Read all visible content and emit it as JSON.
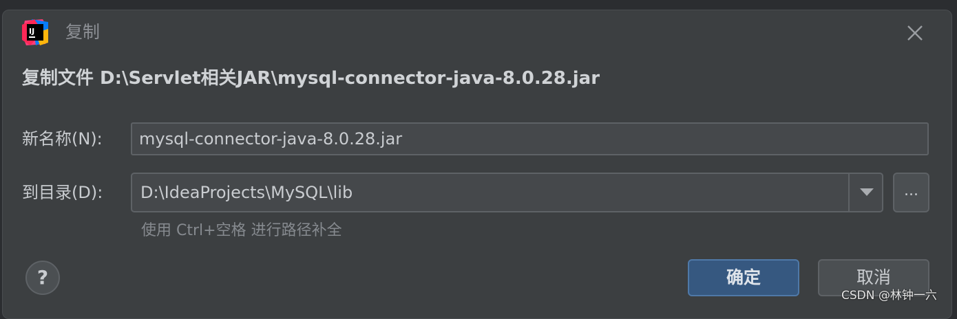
{
  "dialog": {
    "title": "复制",
    "heading": "复制文件 D:\\Servlet相关JAR\\mysql-connector-java-8.0.28.jar"
  },
  "form": {
    "name_label": "新名称(N):",
    "name_value": "mysql-connector-java-8.0.28.jar",
    "dir_label": "到目录(D):",
    "dir_value": "D:\\IdeaProjects\\MySQL\\lib",
    "browse_label": "...",
    "hint": "使用 Ctrl+空格 进行路径补全"
  },
  "buttons": {
    "help_label": "?",
    "ok_label": "确定",
    "cancel_label": "取消"
  },
  "watermark": "CSDN @林钟一六",
  "icons": {
    "app": "intellij-idea-icon",
    "close": "close-icon",
    "dropdown": "chevron-down-icon"
  },
  "colors": {
    "dialog_bg": "#3c3f41",
    "primary_button": "#365880",
    "text": "#c9ccd0"
  }
}
